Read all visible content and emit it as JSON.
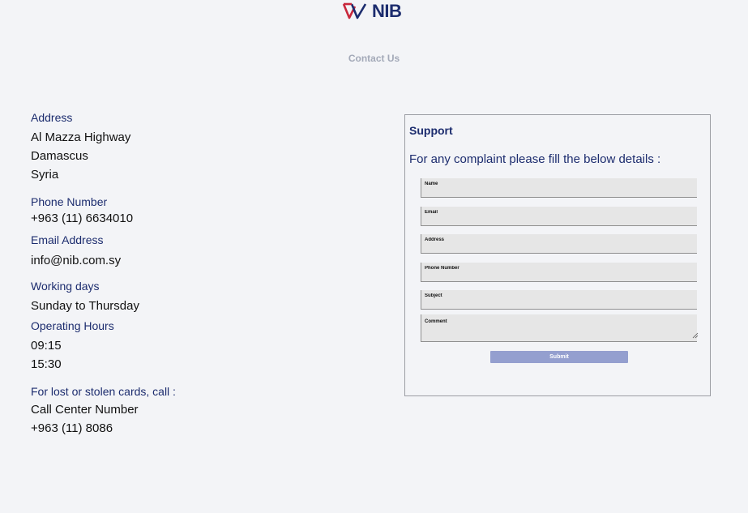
{
  "brand": {
    "name": "NIB",
    "colors": {
      "primary": "#1c2c6e",
      "accent": "#c8283c"
    }
  },
  "page_title": "Contact Us",
  "address": {
    "label": "Address",
    "line1": "Al Mazza Highway",
    "line2": "Damascus",
    "line3": "Syria"
  },
  "phone": {
    "label": "Phone Number",
    "value": "+963 (11) 6634010"
  },
  "email": {
    "label": "Email Address",
    "value": "info@nib.com.sy"
  },
  "working_days": {
    "label": "Working days",
    "value": "Sunday to Thursday"
  },
  "operating_hours": {
    "label": "Operating Hours",
    "open": "09:15",
    "close": "15:30"
  },
  "lost_cards": {
    "label": "For lost or stolen cards, call :",
    "center_label": "Call Center Number",
    "center_number": "+963 (11) 8086"
  },
  "support": {
    "title": "Support",
    "subtitle": "For any complaint please fill the below details :",
    "fields": {
      "name": "Name",
      "email": "Email",
      "address": "Address",
      "phone": "Phone Number",
      "subject": "Subject",
      "comment": "Comment"
    },
    "submit_label": "Submit"
  }
}
